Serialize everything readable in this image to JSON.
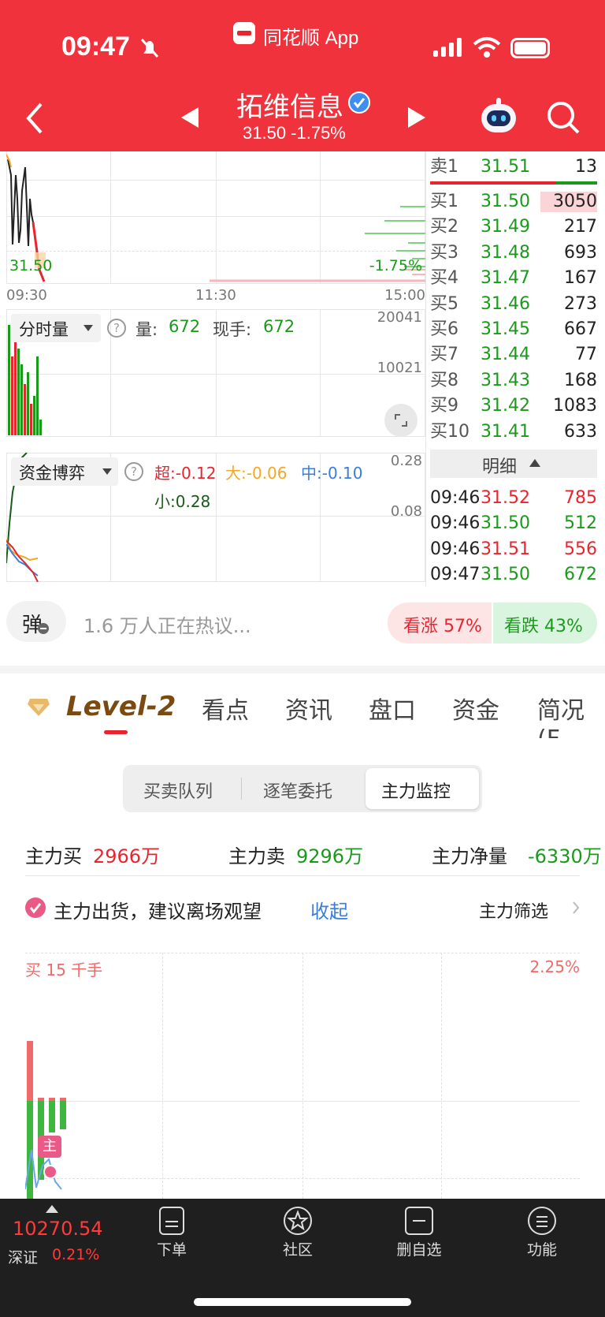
{
  "status_bar": {
    "time": "09:47",
    "app_label": "同花顺 App"
  },
  "header": {
    "stock_name": "拓维信息",
    "price_change": "31.50 -1.75%"
  },
  "intraday": {
    "price_label": "31.50",
    "pct_label": "-1.75%",
    "times": [
      "09:30",
      "11:30",
      "15:00"
    ]
  },
  "volume_panel": {
    "selector": "分时量",
    "volume_label": "量:",
    "volume_value": "672",
    "current_label": "现手:",
    "current_value": "672",
    "axis_top": "20041",
    "axis_mid": "10021"
  },
  "money_panel": {
    "selector": "资金博弈",
    "super": "超:-0.12",
    "large": "大:-0.06",
    "mid": "中:-0.10",
    "small": "小:0.28",
    "axis_top": "0.28",
    "axis_mid": "0.08"
  },
  "order_book": {
    "sell": [
      {
        "label": "卖1",
        "price": "31.51",
        "volume": "13"
      }
    ],
    "buy": [
      {
        "label": "买1",
        "price": "31.50",
        "volume": "3050"
      },
      {
        "label": "买2",
        "price": "31.49",
        "volume": "217"
      },
      {
        "label": "买3",
        "price": "31.48",
        "volume": "693"
      },
      {
        "label": "买4",
        "price": "31.47",
        "volume": "167"
      },
      {
        "label": "买5",
        "price": "31.46",
        "volume": "273"
      },
      {
        "label": "买6",
        "price": "31.45",
        "volume": "667"
      },
      {
        "label": "买7",
        "price": "31.44",
        "volume": "77"
      },
      {
        "label": "买8",
        "price": "31.43",
        "volume": "168"
      },
      {
        "label": "买9",
        "price": "31.42",
        "volume": "1083"
      },
      {
        "label": "买10",
        "price": "31.41",
        "volume": "633"
      }
    ]
  },
  "ticks": {
    "header": "明细",
    "rows": [
      {
        "time": "09:46",
        "price": "31.52",
        "volume": "785"
      },
      {
        "time": "09:46",
        "price": "31.50",
        "volume": "512"
      },
      {
        "time": "09:46",
        "price": "31.51",
        "volume": "556"
      },
      {
        "time": "09:47",
        "price": "31.50",
        "volume": "672"
      }
    ]
  },
  "discussion": {
    "danmu": "弹",
    "text": "1.6 万人正在热议...",
    "bull": "看涨 57%",
    "bear": "看跌 43%"
  },
  "tabs": [
    "Level-2",
    "看点",
    "资讯",
    "盘口",
    "资金",
    "简况(F"
  ],
  "segment": [
    "买卖队列",
    "逐笔委托",
    "主力监控"
  ],
  "main_force": {
    "buy_label": "主力买",
    "buy_value": "2966万",
    "sell_label": "主力卖",
    "sell_value": "9296万",
    "net_label": "主力净量",
    "net_value": "-6330万"
  },
  "alert": {
    "text": "主力出货，建议离场观望",
    "collapse": "收起",
    "filter": "主力筛选"
  },
  "mf_chart": {
    "left_label": "买 15 千手",
    "right_label": "2.25%",
    "marker": "主"
  },
  "bottom_nav": {
    "index_value": "10270.54",
    "index_name": "深证",
    "index_change": "0.21%",
    "items": [
      "下单",
      "社区",
      "删自选",
      "功能"
    ]
  },
  "colors": {
    "header_red": "#f0323c",
    "up_red": "#e8252f",
    "down_green": "#1a9a1a"
  }
}
